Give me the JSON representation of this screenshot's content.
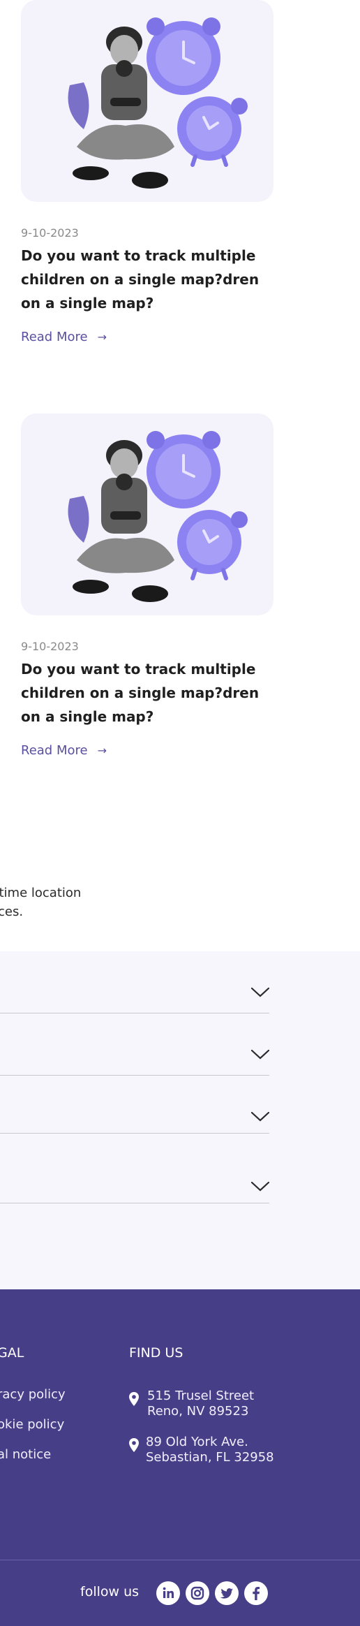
{
  "blog": {
    "posts": [
      {
        "date": "9-10-2023",
        "title": "Do you want to track multiple children on a single map?dren on a single map?",
        "read_more": "Read More",
        "image_icon": "boy-with-alarm-clocks-illustration"
      },
      {
        "date": "9-10-2023",
        "title": "Do you want to track multiple children on a single map?dren on a single map?",
        "read_more": "Read More",
        "image_icon": "boy-with-alarm-clocks-illustration"
      }
    ],
    "arrow_icon": "arrow-right-icon"
  },
  "intro": {
    "line1": "-time location",
    "line2": "ices."
  },
  "faq": {
    "items": [
      {
        "chevron": "chevron-down-icon"
      },
      {
        "chevron": "chevron-down-icon"
      },
      {
        "chevron": "chevron-down-icon"
      },
      {
        "chevron": "chevron-down-icon"
      }
    ]
  },
  "footer": {
    "legal_heading": "GAL",
    "legal_links": [
      "racy policy",
      "okie policy",
      "al notice"
    ],
    "find_us_heading": "FIND US",
    "addresses": [
      {
        "line1": "515 Trusel Street",
        "line2": "Reno, NV 89523"
      },
      {
        "line1": "89 Old York Ave.",
        "line2": "Sebastian, FL 32958"
      }
    ],
    "follow_label": "follow us",
    "social": [
      "linkedin-icon",
      "instagram-icon",
      "twitter-icon",
      "facebook-icon"
    ]
  },
  "colors": {
    "accent": "#5a4fa0",
    "footer_bg": "#473e88",
    "faq_bg": "#f6f6fc",
    "card_bg": "#f4f3fc",
    "clock_purple": "#8c82f2"
  }
}
